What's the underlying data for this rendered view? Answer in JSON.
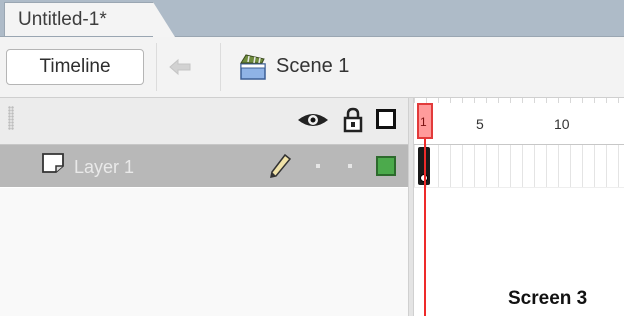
{
  "document": {
    "tab_title": "Untitled-1*"
  },
  "editbar": {
    "timeline_button": "Timeline",
    "back_icon": "back-arrow-icon",
    "scene_icon": "scene-clapper-icon",
    "scene_label": "Scene 1"
  },
  "layers": {
    "header_icons": [
      "eye-icon",
      "lock-icon",
      "outline-icon"
    ],
    "items": [
      {
        "name": "Layer 1",
        "icon": "layer-page-icon",
        "edit_icon": "pencil-icon",
        "color": "#4caa4c",
        "selected": true
      }
    ]
  },
  "timeline": {
    "ticks": [
      "1",
      "5",
      "10"
    ],
    "playhead_frame": "1"
  },
  "caption": "Screen 3",
  "colors": {
    "tab_strip": "#aebbc8",
    "selected_row": "#b8b8b8",
    "playhead": "#ee2a2a",
    "layer_color": "#4caa4c"
  }
}
